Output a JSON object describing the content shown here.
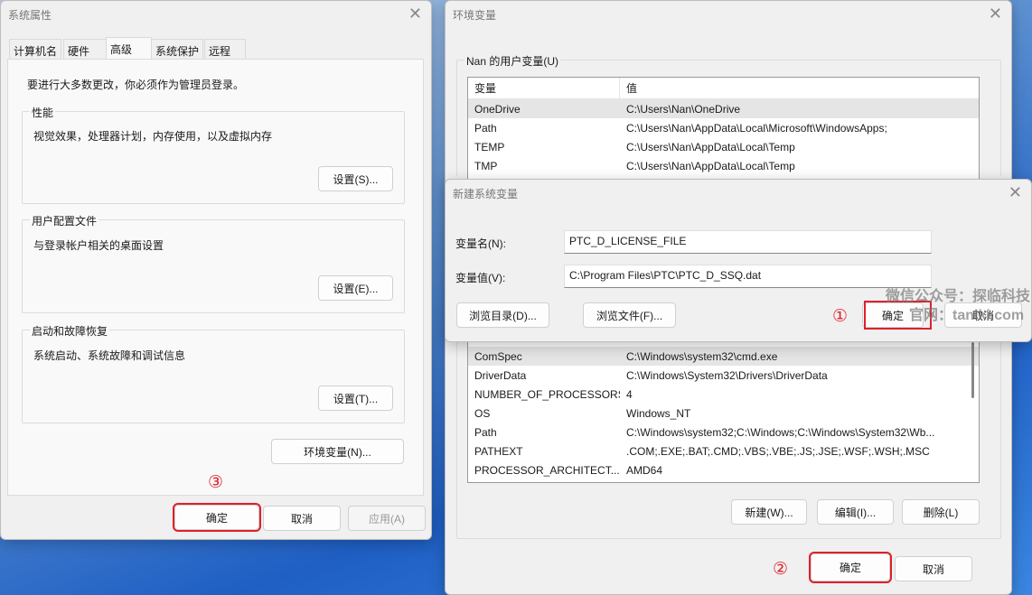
{
  "sysprops": {
    "title": "系统属性",
    "tabs": [
      "计算机名",
      "硬件",
      "高级",
      "系统保护",
      "远程"
    ],
    "admin_note": "要进行大多数更改，你必须作为管理员登录。",
    "perf": {
      "label": "性能",
      "desc": "视觉效果，处理器计划，内存使用，以及虚拟内存",
      "button": "设置(S)..."
    },
    "profile": {
      "label": "用户配置文件",
      "desc": "与登录帐户相关的桌面设置",
      "button": "设置(E)..."
    },
    "startup": {
      "label": "启动和故障恢复",
      "desc": "系统启动、系统故障和调试信息",
      "button": "设置(T)..."
    },
    "env_button": "环境变量(N)...",
    "ok": "确定",
    "cancel": "取消",
    "apply": "应用(A)",
    "step": "③"
  },
  "envvars": {
    "title": "环境变量",
    "user_group": "Nan 的用户变量(U)",
    "col_var": "变量",
    "col_val": "值",
    "user_rows": [
      [
        "OneDrive",
        "C:\\Users\\Nan\\OneDrive"
      ],
      [
        "Path",
        "C:\\Users\\Nan\\AppData\\Local\\Microsoft\\WindowsApps;"
      ],
      [
        "TEMP",
        "C:\\Users\\Nan\\AppData\\Local\\Temp"
      ],
      [
        "TMP",
        "C:\\Users\\Nan\\AppData\\Local\\Temp"
      ]
    ],
    "sys_rows": [
      [
        "ComSpec",
        "C:\\Windows\\system32\\cmd.exe"
      ],
      [
        "DriverData",
        "C:\\Windows\\System32\\Drivers\\DriverData"
      ],
      [
        "NUMBER_OF_PROCESSORS",
        "4"
      ],
      [
        "OS",
        "Windows_NT"
      ],
      [
        "Path",
        "C:\\Windows\\system32;C:\\Windows;C:\\Windows\\System32\\Wb..."
      ],
      [
        "PATHEXT",
        ".COM;.EXE;.BAT;.CMD;.VBS;.VBE;.JS;.JSE;.WSF;.WSH;.MSC"
      ],
      [
        "PROCESSOR_ARCHITECT...",
        "AMD64"
      ]
    ],
    "new": "新建(W)...",
    "edit": "编辑(I)...",
    "delete": "删除(L)",
    "ok": "确定",
    "cancel": "取消",
    "step": "②"
  },
  "newvar": {
    "title": "新建系统变量",
    "name_label": "变量名(N):",
    "name_value": "PTC_D_LICENSE_FILE",
    "value_label": "变量值(V):",
    "value_value": "C:\\Program Files\\PTC\\PTC_D_SSQ.dat",
    "browse_dir": "浏览目录(D)...",
    "browse_file": "浏览文件(F)...",
    "ok": "确定",
    "cancel": "取消",
    "step": "①"
  },
  "watermark": {
    "line1": "微信公众号：探临科技",
    "line2": "官网：tanlki.com"
  }
}
